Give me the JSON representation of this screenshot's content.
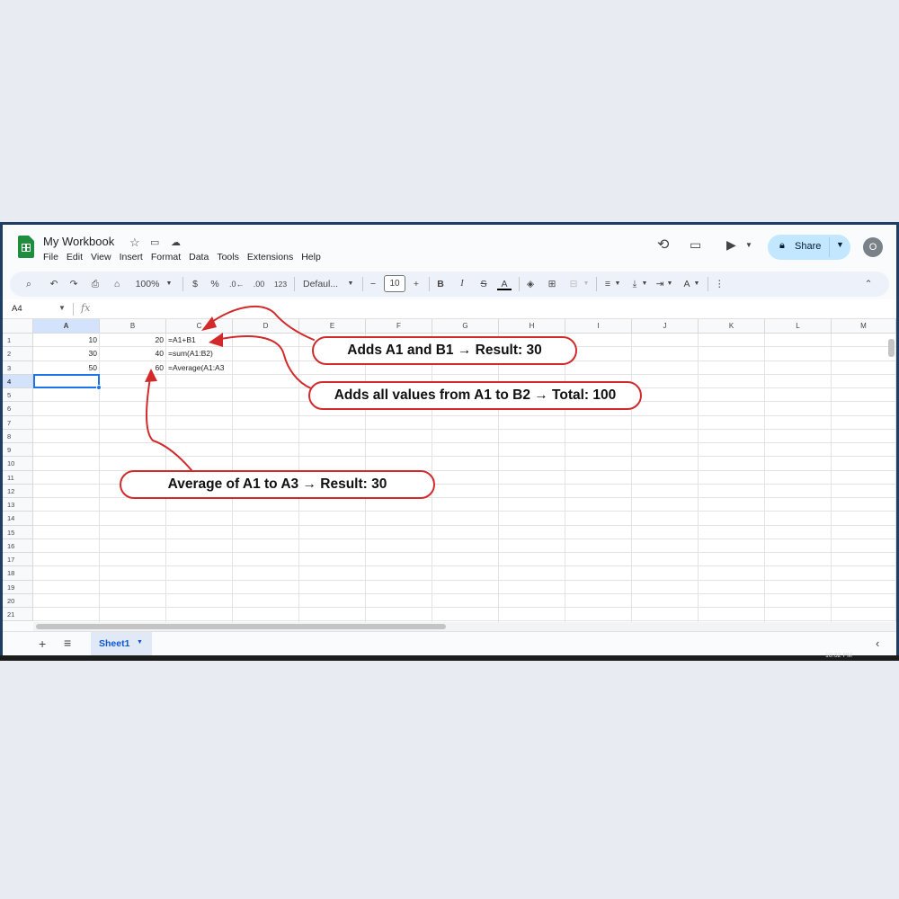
{
  "header": {
    "title": "My Workbook",
    "menu": [
      "File",
      "Edit",
      "View",
      "Insert",
      "Format",
      "Data",
      "Tools",
      "Extensions",
      "Help"
    ],
    "share_label": "Share",
    "avatar_initial": "O"
  },
  "toolbar": {
    "zoom": "100%",
    "currency": "$",
    "percent": "%",
    "decrease_decimal": ".0←",
    "increase_decimal": ".00",
    "number_format": "123",
    "font": "Defaul...",
    "font_size": "10",
    "bold": "B",
    "italic": "I",
    "strike": "S",
    "text_color": "A"
  },
  "formula_bar": {
    "name_box": "A4",
    "fx": "fx"
  },
  "grid": {
    "columns": [
      "A",
      "B",
      "C",
      "D",
      "E",
      "F",
      "G",
      "H",
      "I",
      "J",
      "K",
      "L",
      "M"
    ],
    "rows": [
      "1",
      "2",
      "3",
      "4",
      "5",
      "6",
      "7",
      "8",
      "9",
      "10",
      "11",
      "12",
      "13",
      "14",
      "15",
      "16",
      "17",
      "18",
      "19",
      "20",
      "21"
    ],
    "cells": {
      "A1": "10",
      "B1": "20",
      "C1": "=A1+B1",
      "A2": "30",
      "B2": "40",
      "C2": "=sum(A1:B2)",
      "A3": "50",
      "B3": "60",
      "C3": "=Average(A1:A3"
    }
  },
  "sheet_tabs": {
    "active": "Sheet1"
  },
  "taskbar": {
    "time": "10:32 PM"
  },
  "annotations": {
    "c1": "Adds A1 and B1 → Result: 30",
    "c2": "Adds all values from A1 to B2 → Total: 100",
    "c3": "Average of A1 to A3 → Result: 30"
  },
  "colors": {
    "annotation": "#d22a2a",
    "accent": "#1a73e8",
    "share_bg": "#c2e7ff",
    "logo": "#1e8e3e"
  }
}
